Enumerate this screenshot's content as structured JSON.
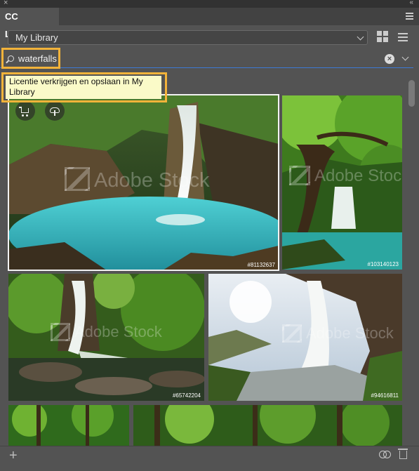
{
  "panel": {
    "tab_title": "CC Libraries",
    "close_glyph": "×",
    "collapse_glyph": "«"
  },
  "library_select": {
    "value": "My Library"
  },
  "search": {
    "value": "waterfalls"
  },
  "tooltip": {
    "text": "Licentie verkrijgen en opslaan in My Library"
  },
  "watermark": "Adobe Stock",
  "images": [
    {
      "id": "#81132637",
      "desc": "waterfall into turquoise pool",
      "selected": true
    },
    {
      "id": "#103140123",
      "desc": "waterfall behind green tree"
    },
    {
      "id": "#65742204",
      "desc": "cascade over rocks in forest"
    },
    {
      "id": "#94616811",
      "desc": "waterfall from cave"
    },
    {
      "id": "",
      "desc": "forest"
    },
    {
      "id": "",
      "desc": "forest"
    }
  ],
  "icons": {
    "search": "search-icon",
    "clear": "clear-search-icon",
    "cart": "license-cart-icon",
    "cloud": "save-to-library-icon",
    "grid": "grid-view-icon",
    "list": "list-view-icon",
    "add": "add-icon",
    "sync": "creative-cloud-sync-icon",
    "trash": "trash-icon"
  },
  "colors": {
    "panel_bg": "#535353",
    "highlight": "#f2b33a",
    "search_underline": "#3d7ad6",
    "tooltip_bg": "#fafac8"
  }
}
